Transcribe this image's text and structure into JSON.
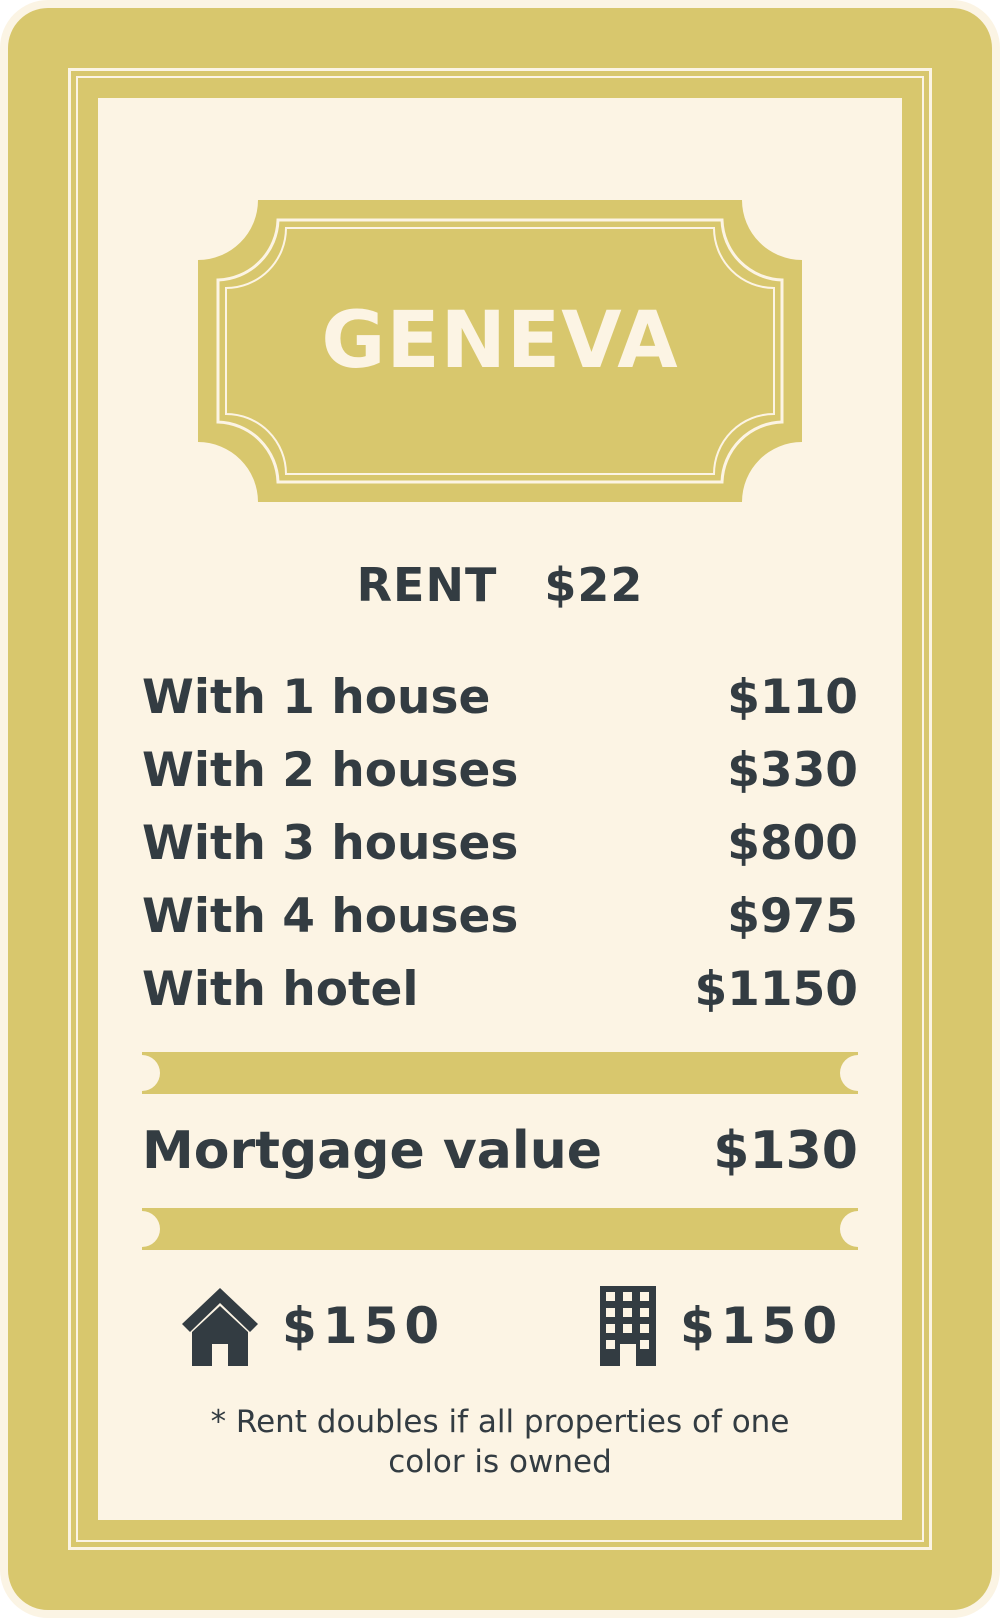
{
  "card": {
    "title": "GENEVA",
    "rent_label": "RENT",
    "rent_value": "$22",
    "rent_rows": [
      {
        "label": "With 1 house",
        "value": "$110"
      },
      {
        "label": "With 2 houses",
        "value": "$330"
      },
      {
        "label": "With 3 houses",
        "value": "$800"
      },
      {
        "label": "With 4 houses",
        "value": "$975"
      },
      {
        "label": "With hotel",
        "value": "$1150"
      }
    ],
    "mortgage_label": "Mortgage value",
    "mortgage_value": "$130",
    "house_cost": {
      "icon": "house-icon",
      "value": "$150"
    },
    "hotel_cost": {
      "icon": "building-icon",
      "value": "$150"
    },
    "footnote_line1": "* Rent doubles if all properties of one",
    "footnote_line2": "color is owned"
  },
  "colors": {
    "gold": "#d8c76d",
    "cream": "#fcf4e4",
    "text": "#333c42"
  }
}
